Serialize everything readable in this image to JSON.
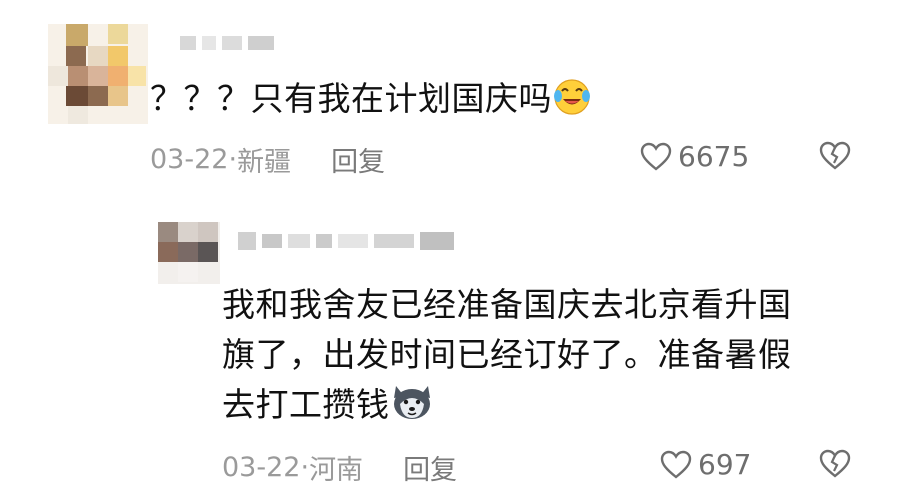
{
  "comments": [
    {
      "text": "？？？只有我在计划国庆吗",
      "date": "03-22",
      "sep": " · ",
      "location": "新疆",
      "reply_label": "回复",
      "likes": "6675",
      "emoji": "laughing-crying-emoji"
    },
    {
      "text_line1": "我和我舍友已经准备国庆去北京看升国",
      "text_line2": "旗了，出发时间已经订好了。准备暑假",
      "text_line3": "去打工攒钱",
      "date": "03-22",
      "sep": " · ",
      "location": "河南",
      "reply_label": "回复",
      "likes": "697",
      "emoji": "husky-dog-emoji"
    }
  ],
  "colors": {
    "meta_text": "#9a9a9a",
    "body_text": "#111111",
    "icon": "#6e6e6e"
  }
}
